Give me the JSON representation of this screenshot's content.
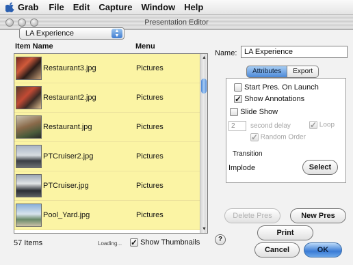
{
  "menubar": {
    "items": [
      "Grab",
      "File",
      "Edit",
      "Capture",
      "Window",
      "Help"
    ]
  },
  "window": {
    "title": "Presentation Editor"
  },
  "presentation_select": {
    "value": "LA Experience"
  },
  "list": {
    "columns": [
      "Item Name",
      "Menu"
    ],
    "rows": [
      {
        "name": "Restaurant3.jpg",
        "menu": "Pictures"
      },
      {
        "name": "Restaurant2.jpg",
        "menu": "Pictures"
      },
      {
        "name": "Restaurant.jpg",
        "menu": "Pictures"
      },
      {
        "name": "PTCruiser2.jpg",
        "menu": "Pictures"
      },
      {
        "name": "PTCruiser.jpg",
        "menu": "Pictures"
      },
      {
        "name": "Pool_Yard.jpg",
        "menu": "Pictures"
      }
    ]
  },
  "status": {
    "items_count": "57 Items",
    "loading": "Loading...",
    "show_thumbnails": "Show Thumbnails",
    "show_thumbnails_checked": true
  },
  "name_field": {
    "label": "Name:",
    "value": "LA Experience"
  },
  "tabs": {
    "attributes": "Attributes",
    "export": "Export"
  },
  "attributes": {
    "start_on_launch": "Start Pres. On Launch",
    "show_annotations": "Show Annotations",
    "slide_show": "Slide Show",
    "seconds_value": "2",
    "second_delay": "second delay",
    "loop": "Loop",
    "random_order": "Random Order",
    "transition_label": "Transition",
    "transition_value": "Implode",
    "select_button": "Select"
  },
  "buttons": {
    "delete_pres": "Delete Pres",
    "new_pres": "New Pres",
    "print": "Print",
    "cancel": "Cancel",
    "ok": "OK"
  },
  "icons": {
    "apple": "apple-logo-icon",
    "help": "help-icon"
  },
  "colors": {
    "row_highlight": "#fbf4a4",
    "accent_blue": "#3a7bd5"
  }
}
